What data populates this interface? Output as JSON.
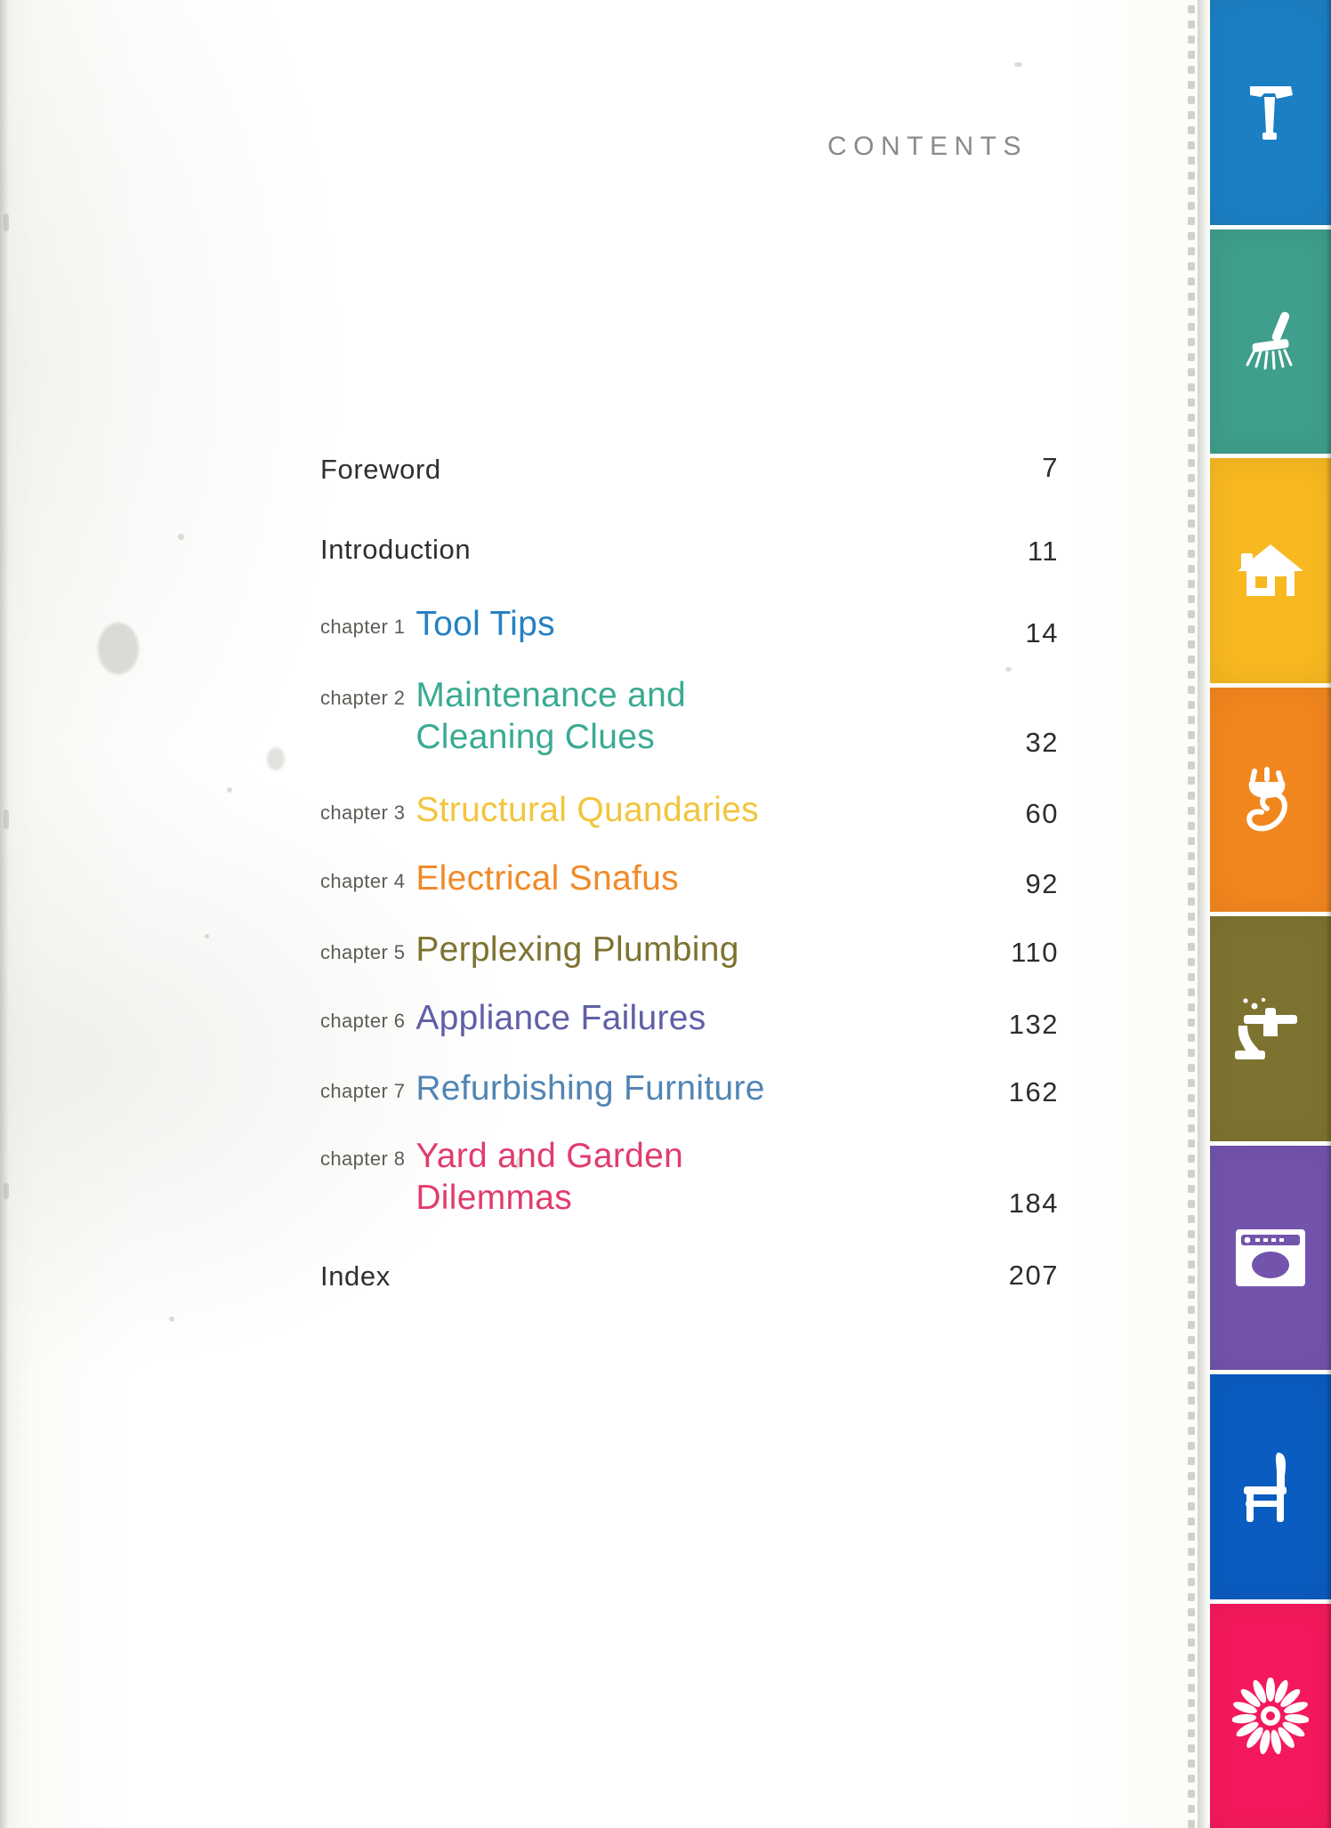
{
  "heading": "CONTENTS",
  "heading_color": "#8a8a8a",
  "entries": [
    {
      "kind": "plain",
      "title": "Foreword",
      "page": "7",
      "color": "#2f2f2f"
    },
    {
      "kind": "plain",
      "title": "Introduction",
      "page": "11",
      "color": "#2f2f2f"
    },
    {
      "kind": "chapter",
      "chapter_label": "chapter 1",
      "title": "Tool Tips",
      "page": "14",
      "color": "#2581c4"
    },
    {
      "kind": "chapter",
      "chapter_label": "chapter 2",
      "title": "Maintenance and\nCleaning Clues",
      "page": "32",
      "color": "#3aaa93"
    },
    {
      "kind": "chapter",
      "chapter_label": "chapter 3",
      "title": "Structural Quandaries",
      "page": "60",
      "color": "#f2c53d"
    },
    {
      "kind": "chapter",
      "chapter_label": "chapter 4",
      "title": "Electrical Snafus",
      "page": "92",
      "color": "#f08a29"
    },
    {
      "kind": "chapter",
      "chapter_label": "chapter 5",
      "title": "Perplexing Plumbing",
      "page": "110",
      "color": "#7d7331"
    },
    {
      "kind": "chapter",
      "chapter_label": "chapter 6",
      "title": "Appliance Failures",
      "page": "132",
      "color": "#5f5fa8"
    },
    {
      "kind": "chapter",
      "chapter_label": "chapter 7",
      "title": "Refurbishing Furniture",
      "page": "162",
      "color": "#2c6ba5"
    },
    {
      "kind": "chapter",
      "chapter_label": "chapter 8",
      "title": "Yard and Garden\nDilemmas",
      "page": "184",
      "color": "#e23b6d"
    },
    {
      "kind": "plain",
      "title": "Index",
      "page": "207",
      "color": "#2f2f2f"
    }
  ],
  "tabs": [
    {
      "icon": "hammer-icon",
      "color": "#1b7fc4"
    },
    {
      "icon": "broom-icon",
      "color": "#3f9e8c"
    },
    {
      "icon": "house-icon",
      "color": "#f7b820"
    },
    {
      "icon": "plug-cord-icon",
      "color": "#f2861e"
    },
    {
      "icon": "faucet-icon",
      "color": "#7d7331"
    },
    {
      "icon": "washing-machine-icon",
      "color": "#7254ac"
    },
    {
      "icon": "chair-icon",
      "color": "#0b5cc0"
    },
    {
      "icon": "flower-icon",
      "color": "#f4195c"
    }
  ]
}
